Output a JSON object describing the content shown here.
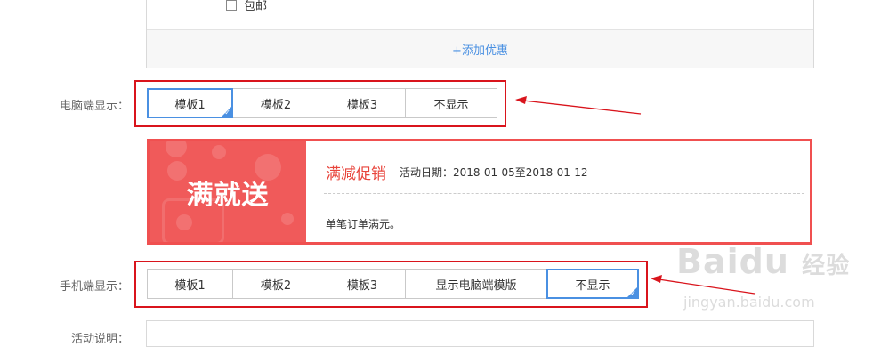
{
  "coupon": {
    "free_shipping_label": "包邮",
    "add_discount_label": "+添加优惠"
  },
  "pc_display": {
    "label": "电脑端显示：",
    "options": [
      "模板1",
      "模板2",
      "模板3",
      "不显示"
    ],
    "selected_index": 0
  },
  "promo": {
    "banner_text": "满就送",
    "title": "满减促销",
    "date_text": "活动日期：2018-01-05至2018-01-12",
    "description": "单笔订单满元。"
  },
  "mobile_display": {
    "label": "手机端显示：",
    "options": [
      "模板1",
      "模板2",
      "模板3",
      "显示电脑端模版",
      "不显示"
    ],
    "selected_index": 4
  },
  "activity_desc": {
    "label": "活动说明："
  },
  "watermark": {
    "brand": "Baidu",
    "suffix": "经验",
    "url": "jingyan.baidu.com"
  },
  "colors": {
    "accent": "#4a90e2",
    "annotation_red": "#d9141c",
    "promo_red": "#f05a5a"
  }
}
